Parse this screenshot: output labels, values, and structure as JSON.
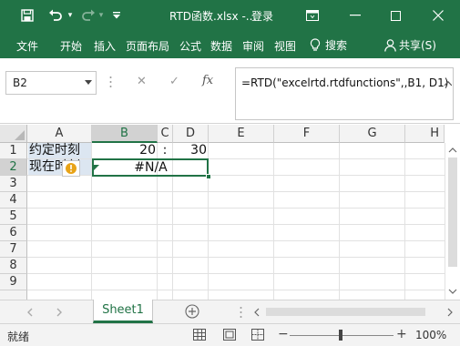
{
  "window": {
    "title": "RTD函数.xlsx  -...",
    "login_label": "登录",
    "accent": "#217346"
  },
  "quick_access": {
    "save_icon": "save-icon",
    "undo_icon": "undo-icon",
    "redo_icon": "redo-icon",
    "customize_icon": "customize-icon"
  },
  "ribbon": {
    "tabs": [
      "文件",
      "开始",
      "插入",
      "页面布局",
      "公式",
      "数据",
      "审阅",
      "视图"
    ],
    "search_label": "搜索",
    "share_label": "共享(S)"
  },
  "formula_bar": {
    "name_box": "B2",
    "fx_label": "fx",
    "formula": "=RTD(\"excelrtd.rtdfunctions\",,B1, D1)"
  },
  "sheet": {
    "columns": [
      "A",
      "B",
      "C",
      "D",
      "E",
      "F",
      "G",
      "H"
    ],
    "rows": [
      "1",
      "2",
      "3",
      "4",
      "5",
      "6",
      "7",
      "8",
      "9"
    ],
    "cells": {
      "A1": "约定时刻",
      "B1": "20",
      "C1": ":",
      "D1": "30",
      "A2": "现在时刻",
      "B2": "#N/A"
    }
  },
  "sheet_tabs": {
    "active": "Sheet1",
    "add_icon": "add-sheet-icon"
  },
  "status_bar": {
    "mode": "就绪",
    "zoom": "100%"
  }
}
